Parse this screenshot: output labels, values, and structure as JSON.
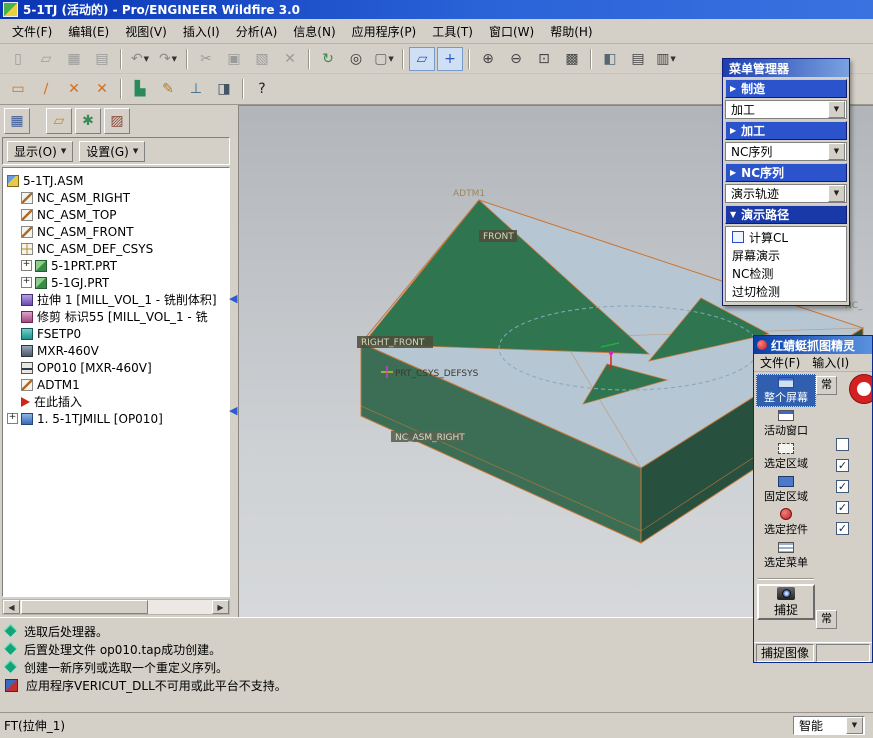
{
  "titlebar": {
    "title": "5-1TJ (活动的) - Pro/ENGINEER Wildfire 3.0"
  },
  "menubar": {
    "items": [
      "文件(F)",
      "编辑(E)",
      "视图(V)",
      "插入(I)",
      "分析(A)",
      "信息(N)",
      "应用程序(P)",
      "工具(T)",
      "窗口(W)",
      "帮助(H)"
    ]
  },
  "toolbar_row1": {
    "icons": [
      {
        "name": "new-file-icon",
        "glyph": "▯",
        "color": "#9a9a9a"
      },
      {
        "name": "open-folder-icon",
        "glyph": "▱",
        "color": "#9a9a9a"
      },
      {
        "name": "save-icon",
        "glyph": "▦",
        "color": "#9a9a9a"
      },
      {
        "name": "print-icon",
        "glyph": "▤",
        "color": "#9a9a9a"
      },
      {
        "sep": true
      },
      {
        "name": "undo-icon",
        "glyph": "↶",
        "color": "#8a8a8a",
        "dropdown": true
      },
      {
        "name": "redo-icon",
        "glyph": "↷",
        "color": "#8a8a8a",
        "dropdown": true
      },
      {
        "sep": true
      },
      {
        "name": "cut-icon",
        "glyph": "✂",
        "color": "#9a9a9a"
      },
      {
        "name": "copy-icon",
        "glyph": "▣",
        "color": "#9a9a9a"
      },
      {
        "name": "paste-icon",
        "glyph": "▧",
        "color": "#9a9a9a"
      },
      {
        "name": "delete-icon",
        "glyph": "✕",
        "color": "#9a9a9a"
      },
      {
        "sep": true
      },
      {
        "name": "regenerate-icon",
        "glyph": "↻",
        "color": "#3a8a4a"
      },
      {
        "name": "search-icon",
        "glyph": "◎",
        "color": "#333333"
      },
      {
        "name": "selection-filter-icon",
        "glyph": "▢",
        "color": "#666666",
        "dropdown": true
      },
      {
        "sep": true
      },
      {
        "name": "datum-display-icon",
        "glyph": "▱",
        "color": "#2a55c8",
        "pressed": true
      },
      {
        "name": "csys-display-icon",
        "glyph": "+",
        "color": "#2a55c8",
        "pressed": true
      },
      {
        "sep": true
      },
      {
        "name": "zoom-in-icon",
        "glyph": "⊕",
        "color": "#444444"
      },
      {
        "name": "zoom-out-icon",
        "glyph": "⊖",
        "color": "#444444"
      },
      {
        "name": "refit-icon",
        "glyph": "⊡",
        "color": "#444444"
      },
      {
        "name": "repaint-icon",
        "glyph": "▩",
        "color": "#444444"
      },
      {
        "sep": true
      },
      {
        "name": "shade-icon",
        "glyph": "◧",
        "color": "#556677"
      },
      {
        "name": "layer-icon",
        "glyph": "▤",
        "color": "#444444"
      },
      {
        "name": "view-manager-icon",
        "glyph": "▥",
        "color": "#444444",
        "dropdown": true
      }
    ]
  },
  "toolbar_row2": {
    "icons": [
      {
        "name": "sketch-region-icon",
        "glyph": "▭",
        "color": "#d4701c"
      },
      {
        "name": "sketch-line-icon",
        "glyph": "∕",
        "color": "#d4701c"
      },
      {
        "name": "datum-point-icon",
        "glyph": "✕",
        "color": "#d4701c"
      },
      {
        "name": "datum-point-offset-icon",
        "glyph": "✕",
        "color": "#d4701c"
      },
      {
        "sep": true
      },
      {
        "name": "workpiece-icon",
        "glyph": "▙",
        "color": "#2a8a5a"
      },
      {
        "name": "annotate-icon",
        "glyph": "✎",
        "color": "#b08020"
      },
      {
        "name": "nc-check-icon",
        "glyph": "⊥",
        "color": "#3a6a8a"
      },
      {
        "name": "mill-icon",
        "glyph": "◨",
        "color": "#445566"
      },
      {
        "sep": true
      },
      {
        "name": "context-help-icon",
        "glyph": "?",
        "color": "#222222"
      }
    ]
  },
  "navigator": {
    "tabs": [
      {
        "name": "model-tree-tab-icon",
        "glyph": "▦",
        "color": "#3a5a9a",
        "gapafter": true
      },
      {
        "name": "folder-browser-tab-icon",
        "glyph": "▱",
        "color": "#c08828"
      },
      {
        "name": "favorites-tab-icon",
        "glyph": "✱",
        "color": "#3a8a5a"
      },
      {
        "name": "connections-tab-icon",
        "glyph": "▨",
        "color": "#8a4a3a"
      }
    ],
    "show_button": "显示(O)",
    "settings_button": "设置(G)",
    "tree": [
      {
        "label": "5-1TJ.ASM",
        "icon": "assembly-icon",
        "indent": 0
      },
      {
        "label": "NC_ASM_RIGHT",
        "icon": "datum-plane-icon",
        "indent": 1
      },
      {
        "label": "NC_ASM_TOP",
        "icon": "datum-plane-icon",
        "indent": 1
      },
      {
        "label": "NC_ASM_FRONT",
        "icon": "datum-plane-icon",
        "indent": 1
      },
      {
        "label": "NC_ASM_DEF_CSYS",
        "icon": "csys-icon",
        "indent": 1
      },
      {
        "label": "5-1PRT.PRT",
        "icon": "part-icon",
        "indent": 1,
        "expand": true
      },
      {
        "label": "5-1GJ.PRT",
        "icon": "part-icon",
        "indent": 1,
        "expand": true
      },
      {
        "label": "拉伸 1 [MILL_VOL_1 - 铣削体积]",
        "icon": "extrude-icon",
        "indent": 1
      },
      {
        "label": "修剪 标识55 [MILL_VOL_1 - 铣",
        "icon": "trim-icon",
        "indent": 1
      },
      {
        "label": "FSETP0",
        "icon": "fixture-icon",
        "indent": 1
      },
      {
        "label": "MXR-460V",
        "icon": "machine-icon",
        "indent": 1
      },
      {
        "label": "OP010 [MXR-460V]",
        "icon": "operation-icon",
        "indent": 1
      },
      {
        "label": "ADTM1",
        "icon": "datum-plane-icon",
        "indent": 1
      },
      {
        "label": "在此插入",
        "icon": "insert-here-icon",
        "indent": 1
      },
      {
        "label": "1. 5-1TJMILL [OP010]",
        "icon": "nc-sequence-icon",
        "indent": 0,
        "expand": true
      }
    ]
  },
  "viewport": {
    "labels": [
      {
        "text": "ADTM1"
      },
      {
        "text": "FRONT"
      },
      {
        "text": "RIGHT_FRONT"
      },
      {
        "text": "PRT_CSYS_DEFSYS"
      },
      {
        "text": "NC_ASM_RIGHT"
      },
      {
        "text": "NC_"
      }
    ]
  },
  "menu_manager": {
    "title": "菜单管理器",
    "rows": [
      {
        "label": "制造",
        "type": "header"
      },
      {
        "label": "加工",
        "type": "dropdown"
      },
      {
        "label": "加工",
        "type": "header"
      },
      {
        "label": "NC序列",
        "type": "dropdown"
      },
      {
        "label": "NC序列",
        "type": "header"
      },
      {
        "label": "演示轨迹",
        "type": "dropdown"
      },
      {
        "label": "演示路径",
        "type": "selected"
      },
      {
        "label": "计算CL",
        "type": "checkbox"
      },
      {
        "label": "屏幕演示",
        "type": "item"
      },
      {
        "label": "NC检测",
        "type": "item"
      },
      {
        "label": "过切检测",
        "type": "item"
      }
    ]
  },
  "capture_tool": {
    "title": "红蜻蜓抓图精灵",
    "menu_items": [
      "文件(F)",
      "输入(I)"
    ],
    "modes": [
      {
        "label": "整个屏幕",
        "icon": "fullscreen-icon",
        "selected": true
      },
      {
        "label": "活动窗口",
        "icon": "active-window-icon"
      },
      {
        "label": "选定区域",
        "icon": "region-icon"
      },
      {
        "label": "固定区域",
        "icon": "fixed-region-icon"
      },
      {
        "label": "选定控件",
        "icon": "control-icon"
      },
      {
        "label": "选定菜单",
        "icon": "menu-capture-icon"
      }
    ],
    "capture_label": "捕捉",
    "status_label": "捕捉图像",
    "side_tab": "常",
    "side_tab2": "常",
    "checkboxes": [
      false,
      true,
      true,
      true,
      true
    ]
  },
  "messages": [
    {
      "icon": "prompt-icon",
      "text": "选取后处理器。"
    },
    {
      "icon": "prompt-icon",
      "text": "后置处理文件 op010.tap成功创建。"
    },
    {
      "icon": "prompt-icon",
      "text": "创建一新序列或选取一个重定义序列。"
    },
    {
      "icon": "app-warning-icon",
      "text": "应用程序VERICUT_DLL不可用或此平台不支持。"
    }
  ],
  "statusbar": {
    "left": "FT(拉伸_1)",
    "smart_select": "智能"
  }
}
